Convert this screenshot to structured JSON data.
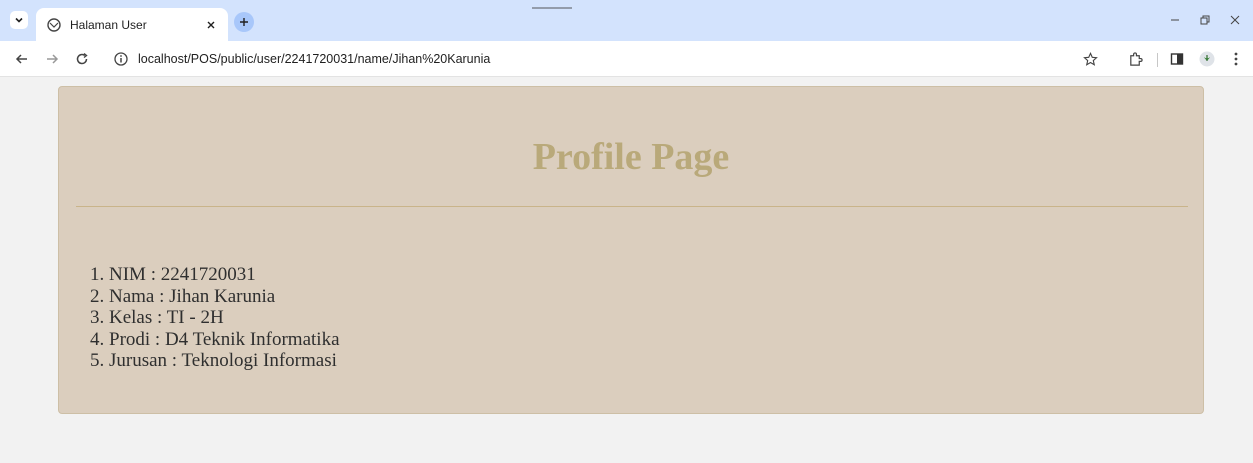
{
  "browser": {
    "tab": {
      "title": "Halaman User"
    },
    "address": {
      "url": "localhost/POS/public/user/2241720031/name/Jihan%20Karunia"
    }
  },
  "page": {
    "heading": "Profile Page",
    "items": [
      "1. NIM : 2241720031",
      "2. Nama : Jihan Karunia",
      "3. Kelas : TI - 2H",
      "4. Prodi : D4 Teknik Informatika",
      "5. Jurusan : Teknologi Informasi"
    ]
  },
  "colors": {
    "tabstrip": "#d3e3fd",
    "page_bg": "#f2f2f2",
    "card_bg": "#dbcebe",
    "heading": "#b9a97a",
    "rule": "#c9b48a"
  },
  "icons": [
    "tab-search-icon",
    "globe-icon",
    "close-icon",
    "plus-icon",
    "minimize-icon",
    "restore-icon",
    "window-close-icon",
    "back-icon",
    "forward-icon",
    "reload-icon",
    "info-icon",
    "star-icon",
    "extensions-icon",
    "side-panel-icon",
    "profile-icon",
    "menu-icon"
  ]
}
